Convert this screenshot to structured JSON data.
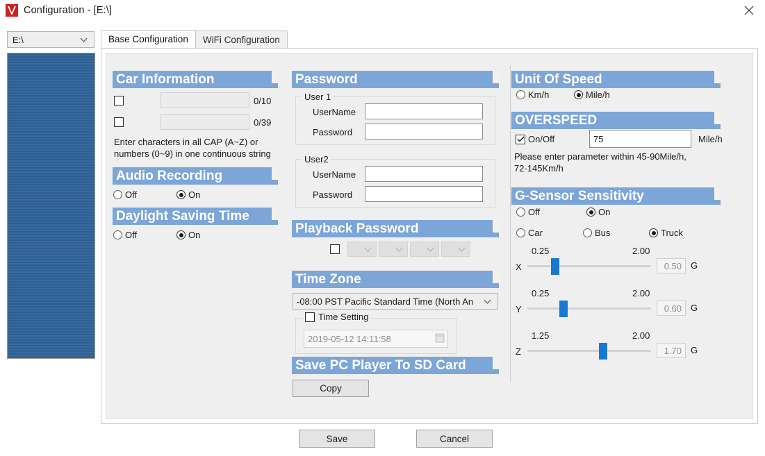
{
  "window": {
    "title": "Configuration - [E:\\]",
    "logo_icon": "app-logo-v-icon",
    "close_icon": "close-icon"
  },
  "drive_select": {
    "value": "E:\\",
    "chevron_icon": "chevron-down-icon"
  },
  "tabs": [
    {
      "label": "Base Configuration",
      "active": true
    },
    {
      "label": "WiFi Configuration",
      "active": false
    }
  ],
  "car_information": {
    "header": "Car Information",
    "row1": {
      "checked": false,
      "value": "",
      "counter": "0/10"
    },
    "row2": {
      "checked": false,
      "value": "",
      "counter": "0/39"
    },
    "hint_line1": "Enter characters in all CAP (A~Z) or",
    "hint_line2": "numbers (0~9) in one continuous string"
  },
  "audio_recording": {
    "header": "Audio Recording",
    "options": [
      {
        "label": "Off",
        "selected": false
      },
      {
        "label": "On",
        "selected": true
      }
    ]
  },
  "daylight_saving_time": {
    "header": "Daylight Saving Time",
    "options": [
      {
        "label": "Off",
        "selected": false
      },
      {
        "label": "On",
        "selected": true
      }
    ]
  },
  "password": {
    "header": "Password",
    "user1": {
      "legend": "User 1",
      "username_label": "UserName",
      "username_value": "",
      "password_label": "Password",
      "password_value": ""
    },
    "user2": {
      "legend": "User2",
      "username_label": "UserName",
      "username_value": "",
      "password_label": "Password",
      "password_value": ""
    }
  },
  "playback_password": {
    "header": "Playback Password",
    "enabled": false,
    "digits": [
      "",
      "",
      "",
      ""
    ],
    "chevron_icon": "chevron-down-icon"
  },
  "time_zone": {
    "header": "Time Zone",
    "value": "-08:00 PST Pacific Standard Time (North An",
    "time_setting_label": "Time Setting",
    "time_setting_checked": false,
    "datetime_value": "2019-05-12 14:11:58",
    "calendar_icon": "calendar-dropdown-icon"
  },
  "save_pc_player": {
    "header": "Save PC Player To SD Card",
    "copy_label": "Copy"
  },
  "unit_of_speed": {
    "header": "Unit Of Speed",
    "options": [
      {
        "label": "Km/h",
        "selected": false
      },
      {
        "label": "Mile/h",
        "selected": true
      }
    ]
  },
  "overspeed": {
    "header": "OVERSPEED",
    "onoff_label": "On/Off",
    "onoff_checked": true,
    "value": "75",
    "unit": "Mile/h",
    "hint_line1": "Please enter parameter within 45-90Mile/h,",
    "hint_line2": "72-145Km/h"
  },
  "gsensor": {
    "header": "G-Sensor Sensitivity",
    "power_options": [
      {
        "label": "Off",
        "selected": false
      },
      {
        "label": "On",
        "selected": true
      }
    ],
    "vehicle_options": [
      {
        "label": "Car",
        "selected": false
      },
      {
        "label": "Bus",
        "selected": false
      },
      {
        "label": "Truck",
        "selected": true
      }
    ],
    "unit": "G",
    "axes": [
      {
        "axis": "X",
        "min": "0.25",
        "max": "2.00",
        "value": "0.50",
        "pct": 14
      },
      {
        "axis": "Y",
        "min": "0.25",
        "max": "2.00",
        "value": "0.60",
        "pct": 20
      },
      {
        "axis": "Z",
        "min": "1.25",
        "max": "2.00",
        "value": "1.70",
        "pct": 58
      }
    ]
  },
  "footer": {
    "save_label": "Save",
    "cancel_label": "Cancel"
  },
  "colors": {
    "section_header_blue": "#7ca5d8",
    "slider_blue": "#1779d0",
    "panel_bg": "#efefef",
    "list_blue": "#2f5f92",
    "logo_red": "#cf2020"
  }
}
